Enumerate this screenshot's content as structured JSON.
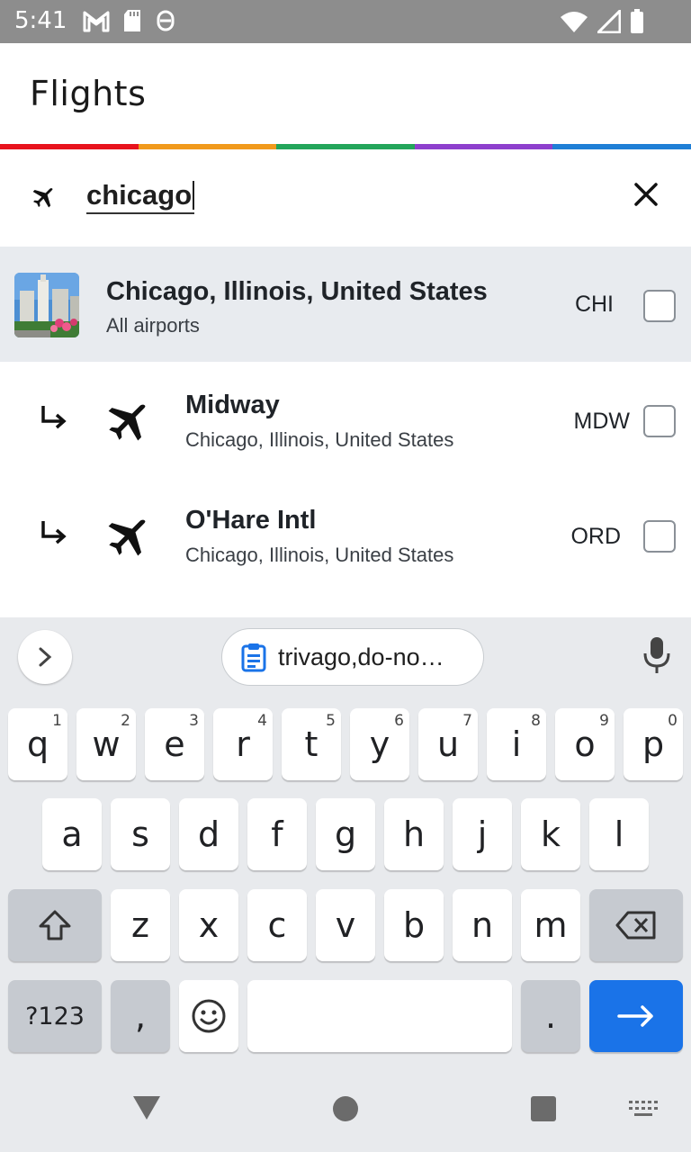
{
  "status_bar": {
    "time": "5:41"
  },
  "header": {
    "title": "Flights"
  },
  "colors": {
    "rainbow": [
      "#e8131d",
      "#f19a1c",
      "#23a55a",
      "#8e3fcd",
      "#1f7fd6"
    ],
    "enter_key": "#1a73e8"
  },
  "search": {
    "value": "chicago"
  },
  "results": {
    "city": {
      "name": "Chicago, Illinois, United States",
      "subtitle": "All airports",
      "code": "CHI"
    },
    "airports": [
      {
        "name": "Midway",
        "location": "Chicago, Illinois, United States",
        "code": "MDW"
      },
      {
        "name": "O'Hare Intl",
        "location": "Chicago, Illinois, United States",
        "code": "ORD"
      }
    ]
  },
  "keyboard": {
    "clipboard_chip": "trivago,do-no…",
    "row1": [
      {
        "key": "q",
        "hint": "1"
      },
      {
        "key": "w",
        "hint": "2"
      },
      {
        "key": "e",
        "hint": "3"
      },
      {
        "key": "r",
        "hint": "4"
      },
      {
        "key": "t",
        "hint": "5"
      },
      {
        "key": "y",
        "hint": "6"
      },
      {
        "key": "u",
        "hint": "7"
      },
      {
        "key": "i",
        "hint": "8"
      },
      {
        "key": "o",
        "hint": "9"
      },
      {
        "key": "p",
        "hint": "0"
      }
    ],
    "row2": [
      "a",
      "s",
      "d",
      "f",
      "g",
      "h",
      "j",
      "k",
      "l"
    ],
    "row3": [
      "z",
      "x",
      "c",
      "v",
      "b",
      "n",
      "m"
    ],
    "symbols_key": "?123",
    "comma_key": ",",
    "period_key": "."
  }
}
